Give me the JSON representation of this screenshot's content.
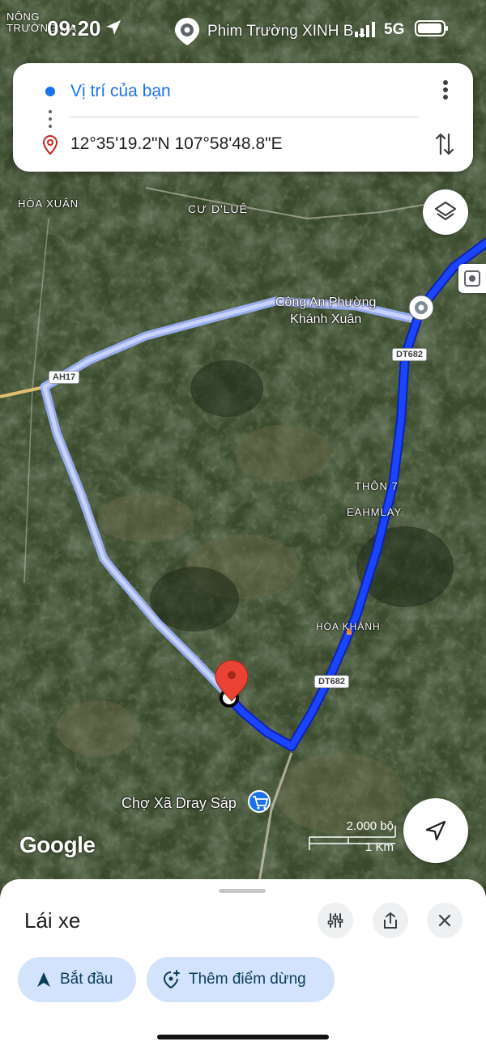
{
  "status_bar": {
    "tiny_place": "NÔNG\nTRƯỜNG MA",
    "time": "09:20",
    "place_name": "Phim Trường XINH B...",
    "network": "5G"
  },
  "directions": {
    "origin": "Vị trí của bạn",
    "destination": "12°35'19.2\"N 107°58'48.8\"E",
    "icons": {
      "origin": "your-location-dot",
      "destination": "place-pin-icon",
      "more": "more-vert-icon",
      "swap": "swap-icon"
    }
  },
  "map": {
    "labels": {
      "hoa_xuan": "HÒA XUÂN",
      "cu_dlue": "CƯ D'LUÊ",
      "cong_an": "Công An Phường\nKhánh Xuân",
      "thon7": "THÔN 7",
      "eahmlay": "EAHMLAY",
      "hoa_khanh": "HÒA KHÁNH",
      "cho": "Chợ Xã Dray Sáp"
    },
    "roads": {
      "ah17": "AH17",
      "dt682_a": "DT682",
      "dt682_b": "DT682"
    },
    "attribution": "Google",
    "scale": {
      "feet": "2.000 bộ",
      "km": "1 Km"
    },
    "colors": {
      "route_primary": "#1a44ff",
      "route_alt": "#b9c6ff",
      "pin_red": "#ea4335"
    }
  },
  "bottom_sheet": {
    "mode": "Lái xe",
    "start_label": "Bắt đầu",
    "add_stop_label": "Thêm điểm dừng",
    "colors": {
      "pill_bg": "#d3e3fd",
      "pill_text": "#0b3d5c"
    }
  }
}
